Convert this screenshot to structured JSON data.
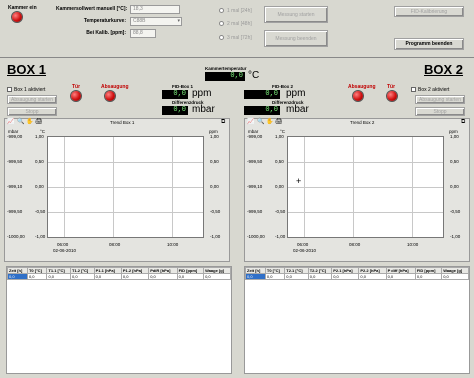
{
  "top": {
    "kammer_label": "Kammer ein",
    "setpoint_label": "Kammersollwert manuell [°C]:",
    "setpoint_value": "18,3",
    "curve_label": "Temperaturkurve:",
    "curve_value": "C88B",
    "calib_label": "Bei Kalib. [ppm]:",
    "calib_value": "88,8",
    "radio1": "1 mal [24h]",
    "radio2": "2 mal [48h]",
    "radio3": "3 mal [72h]",
    "btn_start": "Messung starten",
    "btn_end": "Messung beenden",
    "btn_fid": "FID-Kalibrierung",
    "btn_program_end": "Programm beenden"
  },
  "center": {
    "chamber_temp_label": "Kammertemperatur",
    "chamber_temp_value": "0,0",
    "chamber_temp_unit": "°C",
    "fid1_label": "FID-Box 1",
    "fid1_value": "0,0",
    "fid1_unit": "ppm",
    "dp1_label": "Differenzdruck",
    "dp1_value": "0,0",
    "dp1_unit": "mbar",
    "fid2_label": "FID-Box 2",
    "fid2_value": "0,0",
    "fid2_unit": "ppm",
    "dp2_label": "Differenzdruck",
    "dp2_value": "0,0",
    "dp2_unit": "mbar"
  },
  "box1": {
    "title": "BOX 1",
    "active_label": "Box 1 aktiviert",
    "door_label": "Tür",
    "suction_label": "Absaugung",
    "btn_start": "Absaugung starten",
    "btn_stop": "Stopp"
  },
  "box2": {
    "title": "BOX 2",
    "active_label": "Box 2 aktiviert",
    "door_label": "Tür",
    "suction_label": "Absaugung",
    "btn_start": "Absaugung starten",
    "btn_stop": "Stopp"
  },
  "trend1": {
    "title": "Trend Box 1",
    "left_unit1": "mbar",
    "left_unit2": "°C",
    "right_unit": "ppm",
    "left1_ticks": [
      "-999,00",
      "-999,50",
      "-999,10",
      "-999,50",
      "-1000,00"
    ],
    "left2_ticks": [
      "1,00",
      "0,50",
      "0,00",
      "-0,50",
      "-1,00"
    ],
    "right_ticks": [
      "1,00",
      "0,50",
      "0,00",
      "-0,50",
      "-1,00"
    ],
    "x_ticks": [
      "06:00",
      "08:00",
      "10:00"
    ],
    "date": "02-06-2010"
  },
  "trend2": {
    "title": "Trend Box 2",
    "left_unit1": "mbar",
    "left_unit2": "°C",
    "right_unit": "ppm",
    "left1_ticks": [
      "-999,00",
      "-999,50",
      "-999,10",
      "-999,50",
      "-1000,00"
    ],
    "left2_ticks": [
      "1,00",
      "0,50",
      "0,00",
      "-0,50",
      "-1,00"
    ],
    "right_ticks": [
      "1,00",
      "0,50",
      "0,00",
      "-0,50",
      "-1,00"
    ],
    "x_ticks": [
      "06:00",
      "08:00",
      "10:00"
    ],
    "date": "02-06-2010"
  },
  "table1": {
    "headers": [
      "Zeit [h]",
      "T0 [°C]",
      "T1.1 [°C]",
      "T1.2 [°C]",
      "P1.1 [hPa]",
      "P1.2 [hPa]",
      "PdiR [hPa]",
      "FID [ppm]",
      "Waage [g]"
    ],
    "row": [
      "0,0",
      "0,0",
      "0,0",
      "0,0",
      "0,0",
      "0,0",
      "0,0",
      "0,0",
      "0,0"
    ]
  },
  "table2": {
    "headers": [
      "Zeit [h]",
      "T0 [°C]",
      "T2.1 [°C]",
      "T2.2 [°C]",
      "P2.1 [hPa]",
      "P2.2 [hPa]",
      "P diff [hPa]",
      "FID [ppm]",
      "Waage [g]"
    ],
    "row": [
      "0,0",
      "0,0",
      "0,0",
      "0,0",
      "0,0",
      "0,0",
      "0,0",
      "0,0",
      "0,0"
    ]
  },
  "colors": {
    "background": "#d8d8d0",
    "led_red": "#d01010",
    "display_bg": "#000000"
  }
}
